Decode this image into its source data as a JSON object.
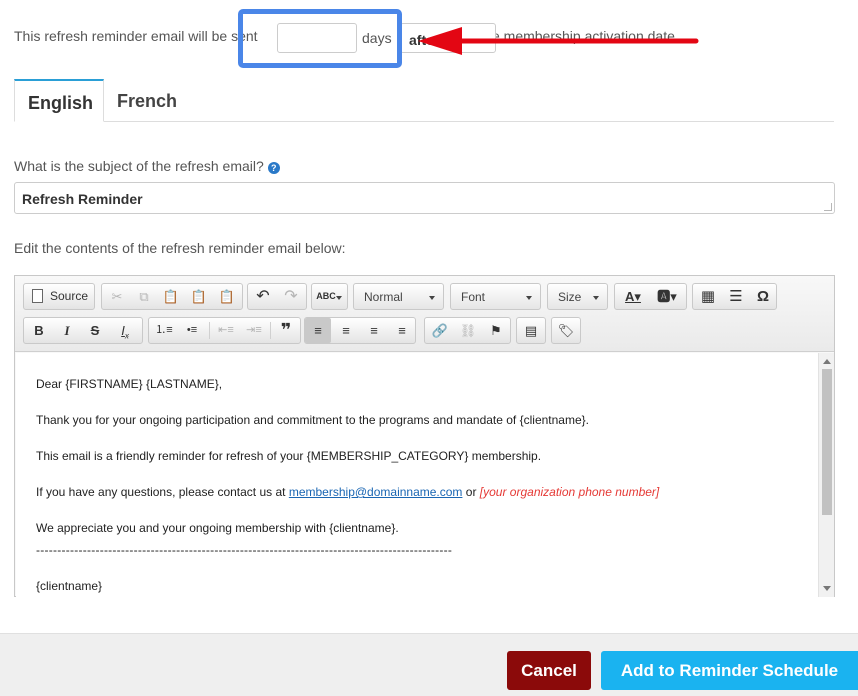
{
  "reminder": {
    "prefix": "This refresh reminder email will be sent",
    "suffix": "the membership activation date.",
    "days_value": "",
    "days_label": "days",
    "timing_selected": "after"
  },
  "tabs": [
    {
      "label": "English",
      "active": true
    },
    {
      "label": "French",
      "active": false
    }
  ],
  "subject": {
    "question": "What is the subject of the refresh email?",
    "help_glyph": "?",
    "value": "Refresh Reminder"
  },
  "editor": {
    "label": "Edit the contents of the refresh reminder email below:",
    "toolbar": {
      "source_label": "Source",
      "format_value": "Normal",
      "font_value": "Font",
      "size_value": "Size"
    },
    "body": {
      "greeting": "Dear {FIRSTNAME} {LASTNAME},",
      "thanks": "Thank you for your ongoing participation and commitment to the programs and mandate of {clientname}.",
      "reminder": "This email is a friendly reminder for refresh of your {MEMBERSHIP_CATEGORY} membership.",
      "contact_prefix": "If you have any questions, please contact us at",
      "contact_email": "membership@domainname.com",
      "contact_or": "or",
      "contact_phone": "[your organization phone number]",
      "appreciate": "We appreciate you and your ongoing membership with {clientname}.",
      "divider": "--------------------------------------------------------------------------------------------------",
      "signature": "{clientname}"
    }
  },
  "footer": {
    "cancel_label": "Cancel",
    "add_label": "Add to Reminder Schedule"
  },
  "colors": {
    "accent": "#2a9fd6",
    "highlight_box": "#4a86e8",
    "arrow": "#e30613",
    "cancel_bg": "#8b0a0a",
    "add_bg": "#1ab3f0"
  }
}
